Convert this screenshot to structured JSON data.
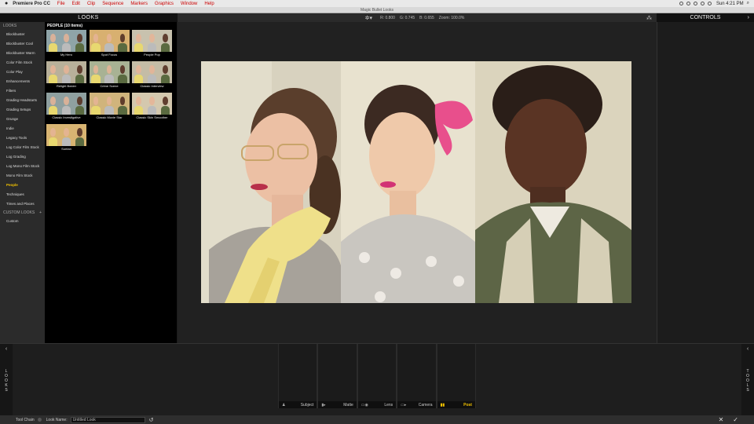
{
  "menubar": {
    "app": "Premiere Pro CC",
    "menus": [
      "File",
      "Edit",
      "Clip",
      "Sequence",
      "Markers",
      "Graphics",
      "Window",
      "Help"
    ],
    "clock": "Sun 4:21 PM"
  },
  "window": {
    "title": "Magic Bullet Looks"
  },
  "looks_panel": {
    "title": "LOOKS"
  },
  "controls_panel": {
    "title": "CONTROLS"
  },
  "viewer_toolbar": {
    "r": "R: 0.800",
    "g": "G: 0.745",
    "b": "B: 0.655",
    "zoom": "Zoom: 100.0%"
  },
  "sidebar": {
    "header": "LOOKS",
    "items": [
      "Blockbuster",
      "Blockbuster Cool",
      "Blockbuster Warm",
      "Color Film Stock",
      "Color Play",
      "Enhancements",
      "Filters",
      "Grading Headstarts",
      "Grading Setups",
      "Grunge",
      "Indie",
      "Legacy Tools",
      "Log Color Film Stock",
      "Log Grading",
      "Log Mono Film Stock",
      "Mono Film Stock",
      "People",
      "Techniques",
      "Times and Places"
    ],
    "selected": "People",
    "custom_header": "CUSTOM LOOKS",
    "custom_items": [
      "Custom"
    ]
  },
  "grid": {
    "title": "PEOPLE (10 items)",
    "thumbs": [
      {
        "label": "My Hero",
        "tint": "#8fa4a8"
      },
      {
        "label": "Spot Focus",
        "tint": "#d8b070"
      },
      {
        "label": "People Pop",
        "tint": "#c8c2ae"
      },
      {
        "label": "Relight Bolder",
        "tint": "#b8b09a"
      },
      {
        "label": "Crime Scene",
        "tint": "#a8b294"
      },
      {
        "label": "Classic Interview",
        "tint": "#c4bca6"
      },
      {
        "label": "Classic Investigative",
        "tint": "#8fa0a0"
      },
      {
        "label": "Classic Movie Star",
        "tint": "#d0b47c"
      },
      {
        "label": "Classic Skin Smoother",
        "tint": "#d4c8ae"
      },
      {
        "label": "Suntan",
        "tint": "#d8b472"
      }
    ]
  },
  "bottom": {
    "left_tab": "LOOKS",
    "right_tab": "TOOLS",
    "chain": [
      {
        "label": "Subject",
        "glyph": "♟"
      },
      {
        "label": "Matte",
        "glyph": "▮▸"
      },
      {
        "label": "Lens",
        "glyph": "▭◉"
      },
      {
        "label": "Camera",
        "glyph": "▭▸"
      },
      {
        "label": "Post",
        "glyph": "▮▮",
        "active": true
      }
    ]
  },
  "statusbar": {
    "tool_chain": "Tool Chain",
    "look_name_label": "Look Name:",
    "look_name_value": "Untitled Look"
  }
}
